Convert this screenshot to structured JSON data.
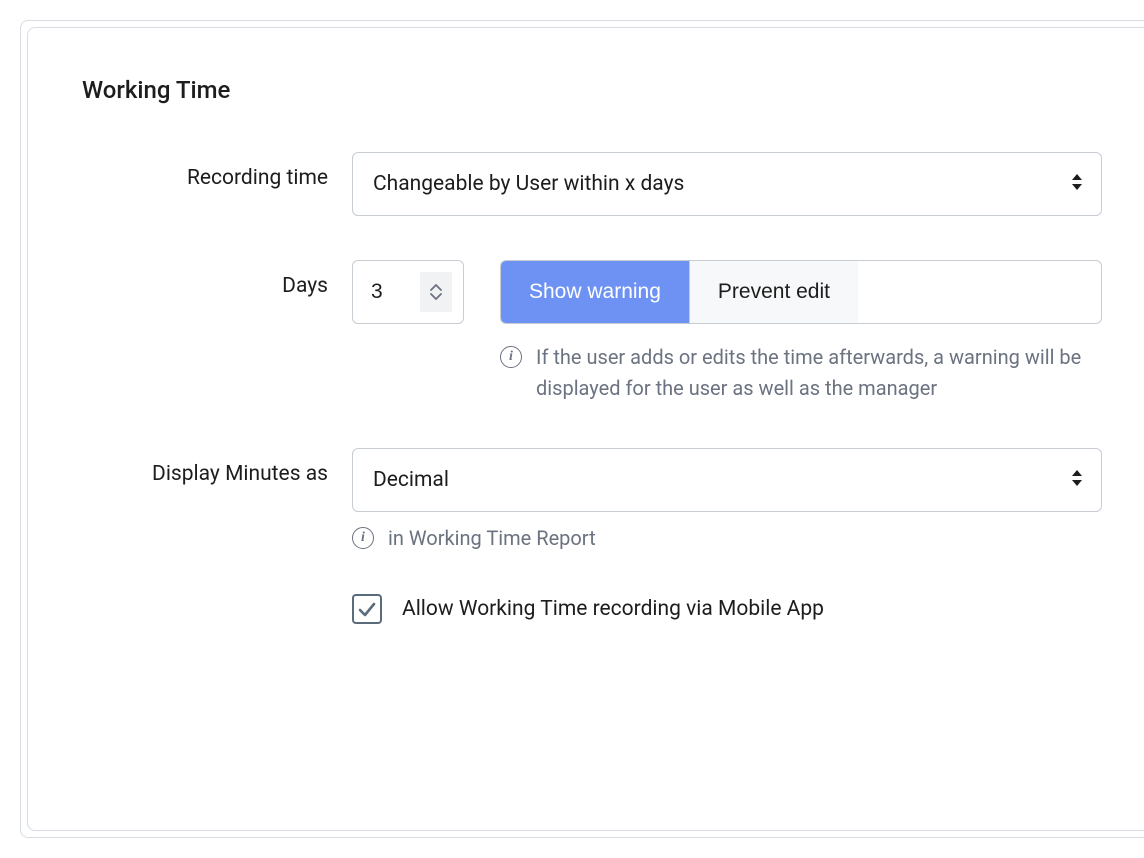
{
  "section": {
    "title": "Working Time"
  },
  "recording_time": {
    "label": "Recording time",
    "value": "Changeable by User within x days"
  },
  "days": {
    "label": "Days",
    "value": "3",
    "segments": {
      "show_warning": "Show warning",
      "prevent_edit": "Prevent edit",
      "active": "show_warning"
    },
    "help": "If the user adds or edits the time afterwards, a warning will be displayed for the user as well as the manager"
  },
  "display_minutes": {
    "label": "Display Minutes as",
    "value": "Decimal",
    "help": "in Working Time Report"
  },
  "allow_mobile": {
    "checked": true,
    "label": "Allow Working Time recording via Mobile App"
  }
}
